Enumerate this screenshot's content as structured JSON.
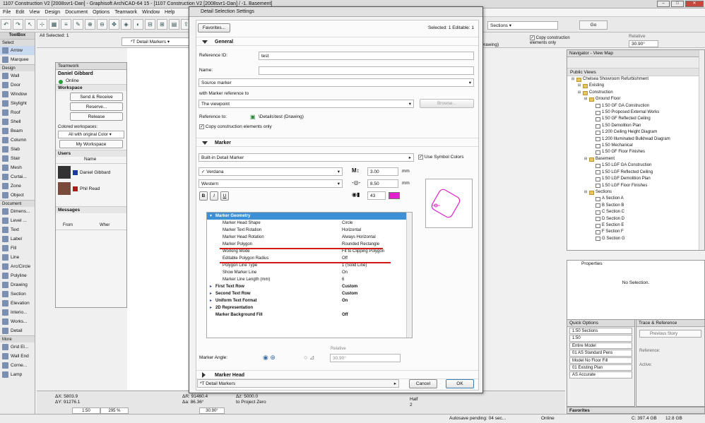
{
  "window": {
    "title": "1107 Construction V2  [2008svr1-Dan] - Graphisoft ArchiCAD-64 15 - [1107 Construction V2  [2008svr1-Dan] / -1. Basement]"
  },
  "menu": [
    "File",
    "Edit",
    "View",
    "Design",
    "Document",
    "Options",
    "Teamwork",
    "Window",
    "Help"
  ],
  "infobox": {
    "all_selected": "All Selected: 1",
    "favorite_label": "*T Detail Markers",
    "sections_label": "Sections",
    "go_label": "Go...",
    "go2_label": "Go",
    "drawing_label": "(Drawing)",
    "copy_label": "Copy construction elements only",
    "relative_label": "Relative",
    "relative_value": "30.90°"
  },
  "toolbox": {
    "title": "ToolBox",
    "select_label": "Select",
    "items_select": [
      "Arrow",
      "Marquee"
    ],
    "design_label": "Design",
    "items_design": [
      "Wall",
      "Door",
      "Window",
      "Skylight",
      "Roof",
      "Shell",
      "Beam",
      "Column",
      "Slab",
      "Stair",
      "Mesh",
      "Curtai...",
      "Zone",
      "Object"
    ],
    "document_label": "Document",
    "items_document": [
      "Dimens...",
      "Level ...",
      "Text",
      "Label",
      "Fill",
      "Line",
      "Arc/Circle",
      "Polyline",
      "Drawing",
      "Section",
      "Elevation",
      "Interio...",
      "Works...",
      "Detail"
    ],
    "more_label": "More",
    "items_more": [
      "Grid El...",
      "Wall End",
      "Corne...",
      "Lamp"
    ]
  },
  "teamwork": {
    "title": "Teamwork",
    "user": "Daniel Gibbard",
    "status": "Online",
    "workspace_label": "Workspace",
    "send_receive": "Send & Receive",
    "reserve": "Reserve...",
    "release": "Release",
    "colored_label": "Colored workspaces:",
    "colored_value": "All with original Color",
    "my_workspace": "My Workspace",
    "users_label": "Users",
    "name_header": "Name",
    "users": [
      "Daniel Gibbard",
      "Phil Read"
    ],
    "messages_label": "Messages",
    "from_header": "From",
    "when_header": "Wher"
  },
  "dialog": {
    "title": "Detail Selection Settings",
    "favorites_btn": "Favorites...",
    "selected_info": "Selected: 1 Editable: 1",
    "general_label": "General",
    "ref_id_label": "Reference ID:",
    "ref_id_value": "test",
    "name_label": "Name:",
    "name_value": "",
    "source_marker": "Source marker",
    "with_ref_label": "with Marker reference to",
    "viewpoint_value": "The viewpoint",
    "browse_btn": "Browse...",
    "ref_to_label": "Reference to:",
    "ref_to_value": "\\Details\\test (Drawing)",
    "copy_construction": "Copy construction elements only",
    "marker_label": "Marker",
    "marker_type": "Built-in Detail Marker",
    "use_symbol_colors": "Use Symbol Colors",
    "font_value": "Verdana",
    "font_size": "3.00",
    "unit_mm": "mm",
    "encoding_value": "Western",
    "offset_value": "8.50",
    "pen_value": "43",
    "bold_label": "B",
    "italic_label": "I",
    "underline_label": "U",
    "geometry_group": "Marker Geometry",
    "properties": [
      {
        "name": "Marker Head Shape",
        "value": "Circle"
      },
      {
        "name": "Marker Text Rotation",
        "value": "Horizontal"
      },
      {
        "name": "Marker Head Rotation",
        "value": "Always Horizontal"
      },
      {
        "name": "Marker Polygon",
        "value": "Rounded Rectangle"
      },
      {
        "name": "Working Mode",
        "value": "Fit to Clipping Polygon"
      },
      {
        "name": "Editable Polygon Radius",
        "value": "Off"
      },
      {
        "name": "Polygon Line Type",
        "value": "1 (Solid Line)"
      },
      {
        "name": "Show Marker Line",
        "value": "On"
      },
      {
        "name": "Marker Line Length (mm)",
        "value": "6"
      }
    ],
    "groups": [
      {
        "name": "First Text Row",
        "value": "Custom"
      },
      {
        "name": "Second Text Row",
        "value": "Custom"
      },
      {
        "name": "Uniform Text Format",
        "value": "On"
      },
      {
        "name": "2D Representation",
        "value": ""
      },
      {
        "name": "Marker Background Fill",
        "value": "Off"
      }
    ],
    "relative_label": "Relative",
    "marker_angle_label": "Marker Angle:",
    "angle_value": "30.90°",
    "marker_head_label": "Marker Head",
    "footer_favorite": "*T Detail Markers",
    "cancel_btn": "Cancel",
    "ok_btn": "OK"
  },
  "navigator": {
    "title": "Navigator - View Map",
    "public_views": "Public Views",
    "tree": [
      {
        "level": 0,
        "label": "Chelsea Showroom Refurbishment",
        "kind": "folder"
      },
      {
        "level": 1,
        "label": "Existing",
        "kind": "folder"
      },
      {
        "level": 1,
        "label": "Construction",
        "kind": "folder"
      },
      {
        "level": 2,
        "label": "Ground Floor",
        "kind": "folder"
      },
      {
        "level": 3,
        "label": "1:50 GF GA Construction",
        "kind": "view"
      },
      {
        "level": 3,
        "label": "1:50 Proposed External Works",
        "kind": "view"
      },
      {
        "level": 3,
        "label": "1:50 GF Reflected Ceiling",
        "kind": "view"
      },
      {
        "level": 3,
        "label": "1:50 Demolition Plan",
        "kind": "view"
      },
      {
        "level": 3,
        "label": "1:200 Ceiling Height Diagram",
        "kind": "view"
      },
      {
        "level": 3,
        "label": "1:200 Illuminated Bulkhead Diagram",
        "kind": "view"
      },
      {
        "level": 3,
        "label": "1:50 Mechanical",
        "kind": "view"
      },
      {
        "level": 3,
        "label": "1:50 GF Floor Finishes",
        "kind": "view"
      },
      {
        "level": 2,
        "label": "Basement",
        "kind": "folder"
      },
      {
        "level": 3,
        "label": "1:50 LGF GA Construction",
        "kind": "view"
      },
      {
        "level": 3,
        "label": "1:50 LGF Reflected Ceiling",
        "kind": "view"
      },
      {
        "level": 3,
        "label": "1:50 LGF Demolition Plan",
        "kind": "view"
      },
      {
        "level": 3,
        "label": "1:50 LGF Floor Finishes",
        "kind": "view"
      },
      {
        "level": 2,
        "label": "Sections",
        "kind": "folder"
      },
      {
        "level": 3,
        "label": "A Section A",
        "kind": "view"
      },
      {
        "level": 3,
        "label": "B Section B",
        "kind": "view"
      },
      {
        "level": 3,
        "label": "C Section C",
        "kind": "view"
      },
      {
        "level": 3,
        "label": "D Section D",
        "kind": "view"
      },
      {
        "level": 3,
        "label": "E Section E",
        "kind": "view"
      },
      {
        "level": 3,
        "label": "F Section F",
        "kind": "view"
      },
      {
        "level": 3,
        "label": "G Section G",
        "kind": "view"
      }
    ]
  },
  "properties_panel": {
    "title": "Properties",
    "empty_text": "No Selection."
  },
  "quick_options": {
    "title": "Quick Options",
    "rows": [
      "1:50 Sections",
      "1:50",
      "Entire Model",
      "01 AS Standard Pens",
      "Model No Floor Fill",
      "01 Existing Plan",
      "AS Accurate"
    ]
  },
  "trace": {
    "title": "Trace & Reference",
    "previous_story": "Previous Story",
    "reference_label": "Reference:",
    "active_label": "Active:"
  },
  "favorites_panel": {
    "title": "Favorites"
  },
  "coords": {
    "dx_label": "ΔX: 5803.9",
    "dy_label": "ΔY: 91276.1",
    "ar_label": "ΔR: 91460.4",
    "aa_label": "Δa: 86.36°",
    "z_label": "Δz: 5000.0",
    "to_zero": "to Project Zero",
    "scale": "1:50",
    "zoom": "295 %",
    "angle": "30.90°",
    "half_label": "Half",
    "half_num": "2"
  },
  "status": {
    "autosave": "Autosave pending: 04 sec...",
    "online": "Online",
    "drive_c": "C: 397.4 GB",
    "ram": "12.8 GB"
  },
  "colors": {
    "accent": "#3d8fd6",
    "red_underline": "#d31818",
    "preview_marker": "#e020c8"
  }
}
